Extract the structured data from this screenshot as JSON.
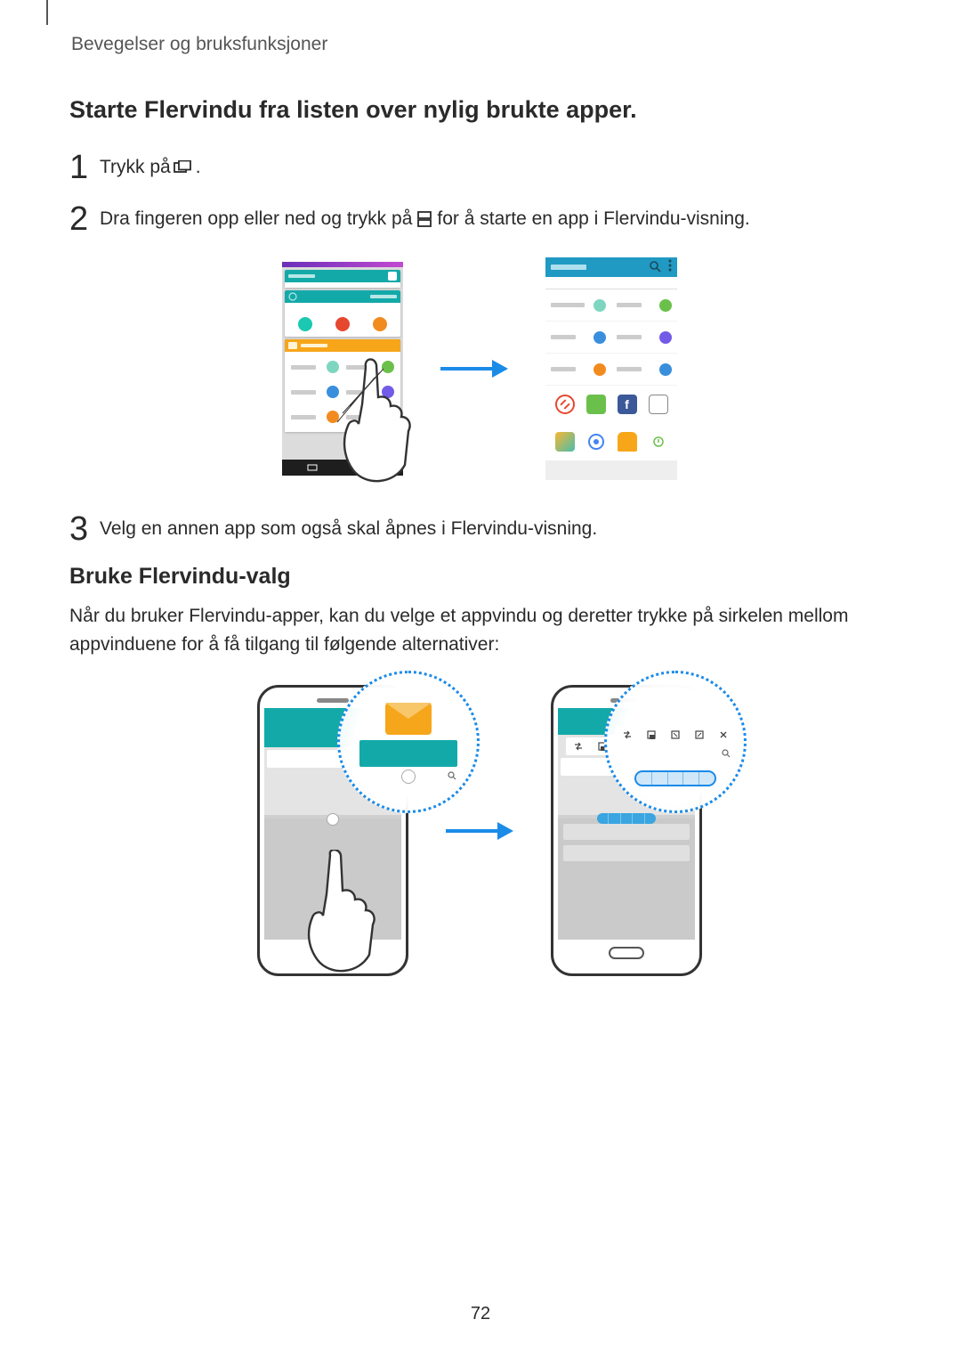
{
  "breadcrumb": "Bevegelser og bruksfunksjoner",
  "heading1": "Starte Flervindu fra listen over nylig brukte apper.",
  "step1": {
    "num": "1",
    "text_before": "Trykk på ",
    "text_after": "."
  },
  "step2": {
    "num": "2",
    "text_before": "Dra fingeren opp eller ned og trykk på ",
    "text_after": " for å starte en app i Flervindu-visning."
  },
  "step3": {
    "num": "3",
    "text": "Velg en annen app som også skal åpnes i Flervindu-visning."
  },
  "heading2": "Bruke Flervindu-valg",
  "body2": "Når du bruker Flervindu-apper, kan du velge et appvindu og deretter trykke på sirkelen mellom appvinduene for å få tilgang til følgende alternativer:",
  "pageNumber": "72"
}
